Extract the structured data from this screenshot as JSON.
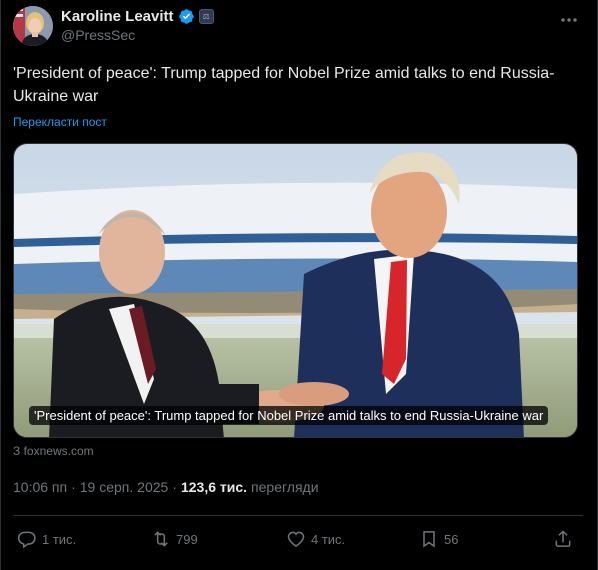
{
  "author": {
    "display_name": "Karoline Leavitt",
    "handle": "@PressSec",
    "verified_icon": "verified-badge-icon",
    "affiliation_badge": "⚖"
  },
  "post": {
    "text": "'President of peace': Trump tapped for Nobel Prize amid talks to end Russia-Ukraine war",
    "translate_label": "Перекласти пост"
  },
  "card": {
    "caption": "'President of peace': Trump tapped for Nobel Prize amid talks to end Russia-Ukraine war",
    "source": "З foxnews.com"
  },
  "meta": {
    "time": "10:06 пп",
    "date": "19 серп. 2025",
    "separator": "·",
    "views": "123,6 тис.",
    "views_label": "перегляди"
  },
  "actions": {
    "reply_count": "1 тис.",
    "repost_count": "799",
    "like_count": "4 тис.",
    "bookmark_count": "56"
  },
  "colors": {
    "background": "#000000",
    "text": "#e7e9ea",
    "secondary": "#71767b",
    "link": "#1d9bf0",
    "verified": "#1d9bf0"
  }
}
